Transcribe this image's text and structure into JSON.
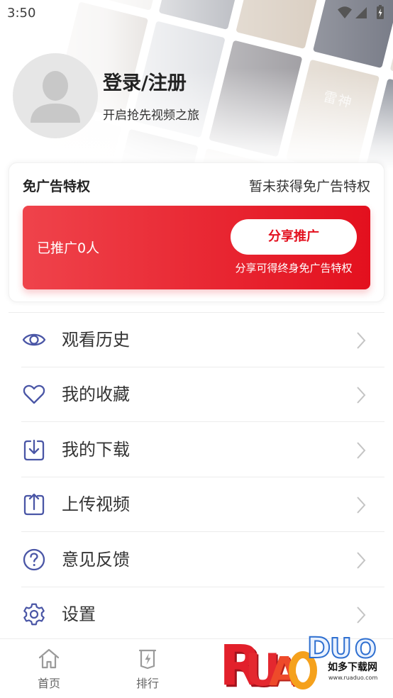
{
  "status_bar": {
    "time": "3:50"
  },
  "hero": {
    "poster_titles": [
      "雷神"
    ]
  },
  "profile": {
    "title": "登录/注册",
    "subtitle": "开启抢先视频之旅"
  },
  "ad_free": {
    "title": "免广告特权",
    "status": "暂未获得免广告特权",
    "promoted_text": "已推广0人",
    "share_button": "分享推广",
    "share_hint": "分享可得终身免广告特权"
  },
  "menu": [
    {
      "label": "观看历史",
      "icon": "eye-icon"
    },
    {
      "label": "我的收藏",
      "icon": "heart-icon"
    },
    {
      "label": "我的下载",
      "icon": "download-icon"
    },
    {
      "label": "上传视频",
      "icon": "upload-icon"
    },
    {
      "label": "意见反馈",
      "icon": "question-icon"
    },
    {
      "label": "设置",
      "icon": "gear-icon"
    }
  ],
  "bottom_nav": [
    {
      "label": "首页",
      "icon": "home-icon"
    },
    {
      "label": "排行",
      "icon": "rank-icon"
    }
  ],
  "watermark": {
    "wordmark": [
      "R",
      "U",
      "A",
      "D",
      "U",
      "O"
    ],
    "site_name": "如多下载网",
    "url": "www.ruaduo.com"
  },
  "colors": {
    "icon_accent": "#4a56a6",
    "banner_start": "#ef434b",
    "banner_end": "#e3101e",
    "share_text": "#e3101e",
    "text": "#333333",
    "chevron": "#c4c4c4",
    "nav_icon": "#9a9a9a"
  }
}
